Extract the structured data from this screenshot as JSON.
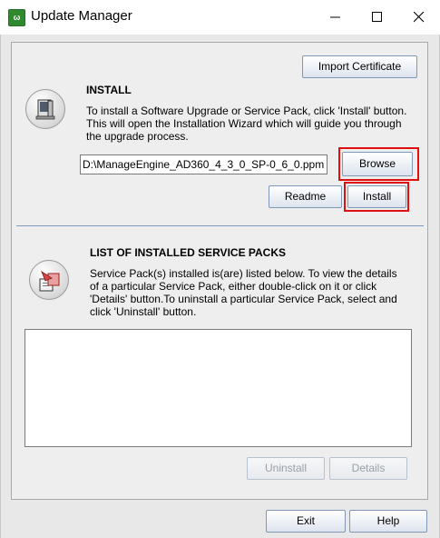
{
  "window": {
    "title": "Update Manager",
    "app_icon_text": "ω",
    "controls": {
      "minimize": "—",
      "maximize": "☐",
      "close": "✕"
    }
  },
  "install": {
    "import_certificate_label": "Import Certificate",
    "heading": "INSTALL",
    "description_lines": [
      "To install a Software Upgrade or Service Pack, click 'Install' button.",
      "This will open the Installation Wizard which will guide you through",
      "the upgrade process."
    ],
    "path_value": "D:\\ManageEngine_AD360_4_3_0_SP-0_6_0.ppm",
    "browse_label": "Browse",
    "readme_label": "Readme",
    "install_label": "Install"
  },
  "service_packs": {
    "heading": "LIST OF INSTALLED SERVICE PACKS",
    "description_lines": [
      "Service Pack(s) installed is(are) listed below. To view the details",
      "of a particular Service Pack, either double-click on it or click",
      "'Details' button.To uninstall a particular Service Pack, select and",
      "click 'Uninstall' button."
    ],
    "items": [],
    "uninstall_label": "Uninstall",
    "details_label": "Details"
  },
  "footer": {
    "exit_label": "Exit",
    "help_label": "Help"
  },
  "colors": {
    "highlight": "#e01010",
    "separator": "#7d9bc0",
    "panel": "#eeeeee"
  }
}
